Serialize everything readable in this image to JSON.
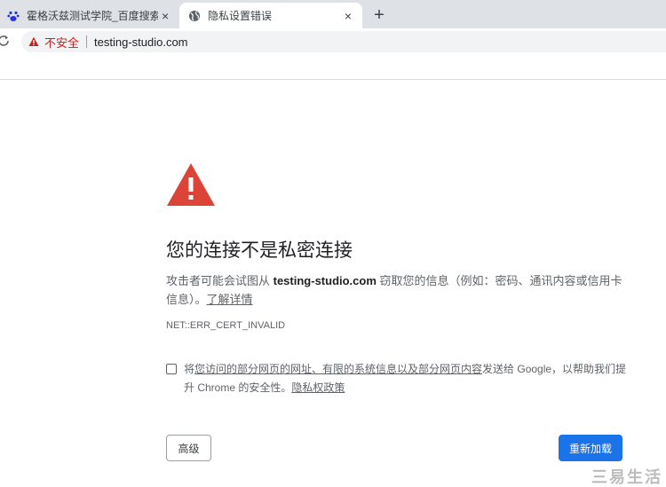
{
  "tabs": [
    {
      "title": "霍格沃兹测试学院_百度搜索",
      "icon": "baidu-paw-icon",
      "close": "×"
    },
    {
      "title": "隐私设置错误",
      "icon": "globe-icon",
      "close": "×",
      "active": true
    }
  ],
  "new_tab": "+",
  "address_bar": {
    "security_label": "不安全",
    "url": "testing-studio.com"
  },
  "interstitial": {
    "heading": "您的连接不是私密连接",
    "desc_prefix": "攻击者可能会试图从 ",
    "desc_domain": "testing-studio.com",
    "desc_suffix": " 窃取您的信息（例如：密码、通讯内容或信用卡信息）。",
    "learn_more": "了解详情",
    "error_code": "NET::ERR_CERT_INVALID",
    "optin_prefix": "将",
    "optin_link": "您访问的部分网页的网址、有限的系统信息以及部分网页内容",
    "optin_suffix": "发送给 Google，以帮助我们提升 Chrome 的安全性。",
    "privacy_link": "隐私权政策",
    "advanced_button": "高级",
    "reload_button": "重新加载"
  },
  "watermark": "三易生活",
  "colors": {
    "accent": "#1a73e8",
    "warning": "#db4437",
    "insecure_text": "#c5221f"
  }
}
